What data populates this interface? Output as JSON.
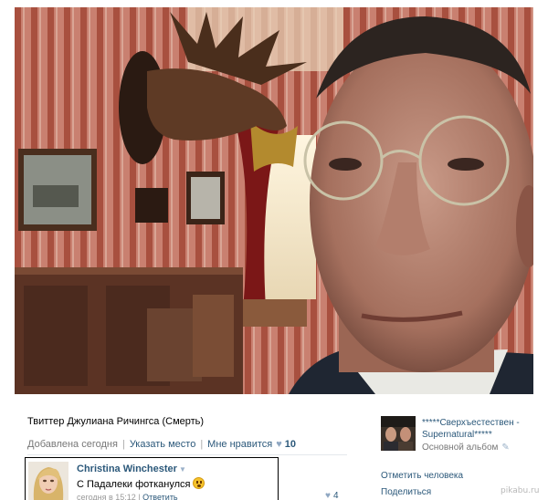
{
  "photo": {
    "alt_icon": "selfie-photo"
  },
  "info": {
    "description": "Твиттер Джулиана Ричингса (Смерть)",
    "added": "Добавлена сегодня",
    "location_link": "Указать место",
    "like_link": "Мне нравится",
    "like_count": "10"
  },
  "comment": {
    "author": "Christina Winchester",
    "text": "С Падалеки фотканулся",
    "time": "сегодня в 15:12",
    "reply": "Ответить",
    "like_count": "4"
  },
  "album": {
    "title": "*****Сверхъестествен - Supernatural*****",
    "subtitle": "Основной альбом"
  },
  "actions": {
    "tag_person": "Отметить человека",
    "share": "Поделиться"
  },
  "watermark": "pikabu.ru",
  "colors": {
    "link": "#2b587a",
    "muted": "#777777",
    "heart": "#8fa7c2"
  }
}
